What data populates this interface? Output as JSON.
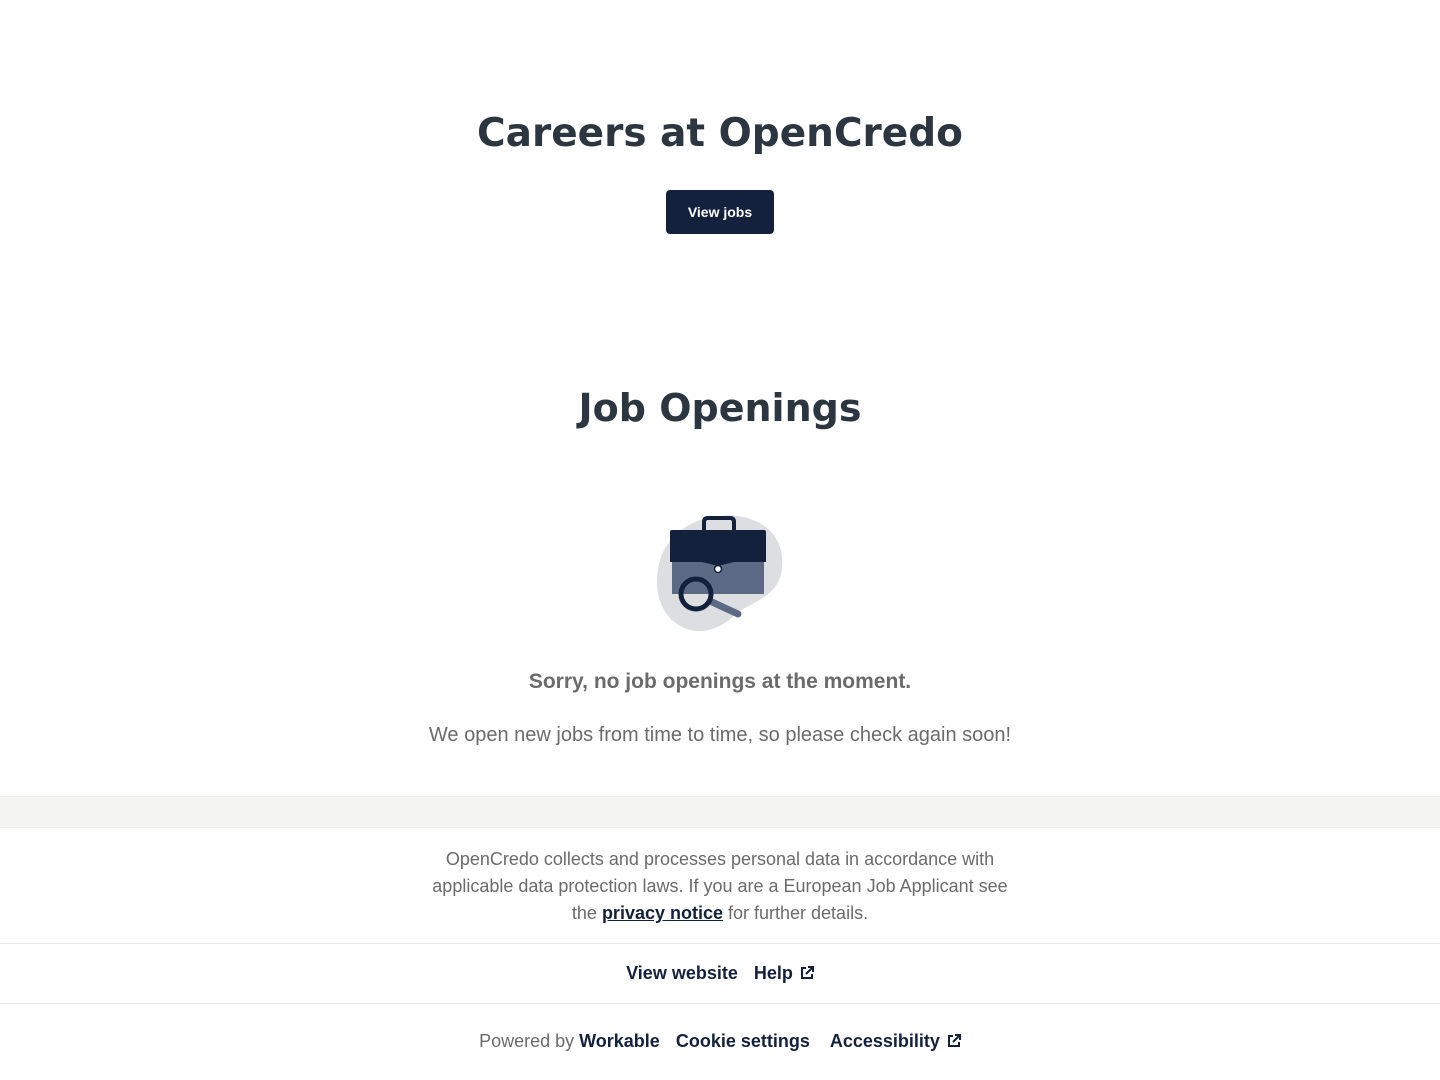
{
  "hero": {
    "title": "Careers at OpenCredo",
    "view_jobs_label": "View jobs"
  },
  "openings": {
    "title": "Job Openings",
    "empty_heading": "Sorry, no job openings at the moment.",
    "empty_message": "We open new jobs from time to time, so please check again soon!",
    "illustration_icon": "briefcase-search-icon"
  },
  "privacy": {
    "text_before": "OpenCredo collects and processes personal data in accordance with applicable data protection laws. If you are a European Job Applicant see the ",
    "link_label": "privacy notice",
    "text_after": " for further details."
  },
  "footer": {
    "view_website": "View website",
    "help": "Help",
    "powered_by": "Powered by ",
    "workable": "Workable",
    "cookie_settings": "Cookie settings",
    "accessibility": "Accessibility",
    "external_icon": "external-link-icon"
  },
  "colors": {
    "primary": "#14213d",
    "heading": "#2b3640",
    "muted_text": "#6b6b6b",
    "band": "#f4f4f1"
  }
}
